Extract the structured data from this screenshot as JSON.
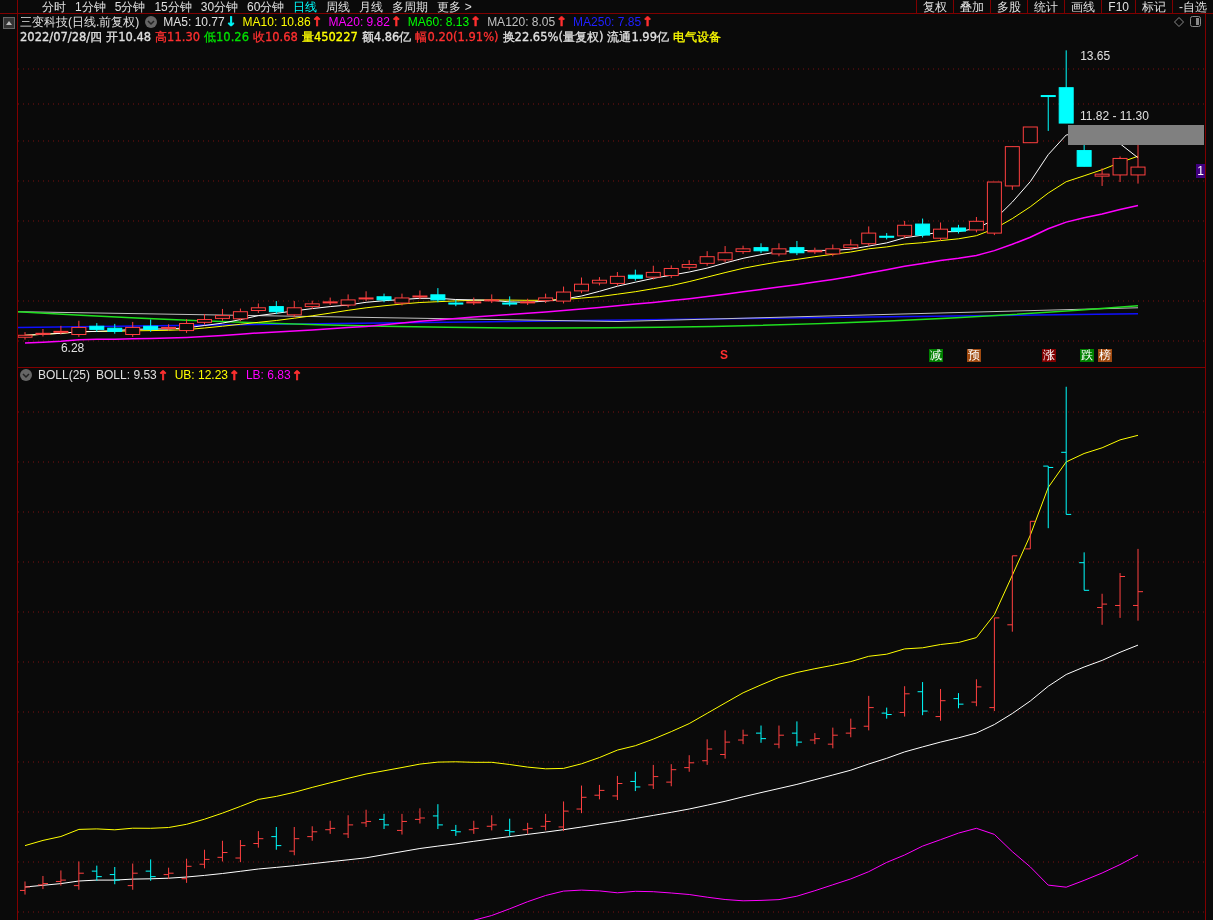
{
  "toolbar": {
    "tabs": [
      {
        "label": "分时",
        "selected": false
      },
      {
        "label": "1分钟",
        "selected": false
      },
      {
        "label": "5分钟",
        "selected": false
      },
      {
        "label": "15分钟",
        "selected": false
      },
      {
        "label": "30分钟",
        "selected": false
      },
      {
        "label": "60分钟",
        "selected": false
      },
      {
        "label": "日线",
        "selected": true
      },
      {
        "label": "周线",
        "selected": false
      },
      {
        "label": "月线",
        "selected": false
      },
      {
        "label": "多周期",
        "selected": false
      },
      {
        "label": "更多 >",
        "selected": false
      }
    ],
    "buttons": [
      "复权",
      "叠加",
      "多股",
      "统计",
      "画线",
      "F10",
      "标记",
      "-自选"
    ]
  },
  "header": {
    "title": "三变科技(日线.前复权)",
    "indicators": [
      {
        "label": "MA5: 10.77",
        "color": "#e0e0e0",
        "arrow": {
          "text": "↓",
          "color": "#00ffff"
        }
      },
      {
        "label": "MA10: 10.86",
        "color": "#ffff00",
        "arrow": {
          "text": "↑",
          "color": "#ff3030"
        }
      },
      {
        "label": "MA20: 9.82",
        "color": "#ff00ff",
        "arrow": {
          "text": "↑",
          "color": "#ff3030"
        }
      },
      {
        "label": "MA60: 8.13",
        "color": "#00ff00",
        "arrow": {
          "text": "↑",
          "color": "#ff3030"
        }
      },
      {
        "label": "MA120: 8.05",
        "color": "#c0c0c0",
        "arrow": {
          "text": "↑",
          "color": "#ff3030"
        }
      },
      {
        "label": "MA250: 7.85",
        "color": "#2020ff",
        "arrow": {
          "text": "↑",
          "color": "#ff3030"
        }
      }
    ],
    "quote": [
      {
        "text": "2022/07/28/四",
        "color": "#e0e0e0"
      },
      {
        "text": "开10.48",
        "color": "#e0e0e0"
      },
      {
        "text": "高11.30",
        "color": "#ff3030"
      },
      {
        "text": "低10.26",
        "color": "#00e000"
      },
      {
        "text": "收10.68",
        "color": "#ff3030"
      },
      {
        "text": "量450227",
        "color": "#ffff00"
      },
      {
        "text": "额4.86亿",
        "color": "#e0e0e0"
      },
      {
        "text": "幅0.20(1.91%)",
        "color": "#ff3030"
      },
      {
        "text": "换22.65%(量复权)",
        "color": "#e0e0e0"
      },
      {
        "text": "流通1.99亿",
        "color": "#e0e0e0"
      },
      {
        "text": "电气设备",
        "color": "#ffff00"
      }
    ]
  },
  "price_chart": {
    "high_label": "13.65",
    "range_label": "11.82 - 11.30",
    "low_label": "6.28",
    "axis_label": "1",
    "signals": [
      {
        "text": "S",
        "kind": "letter",
        "color": "#ff3030"
      },
      {
        "text": "减",
        "kind": "badge",
        "color": "#008000"
      },
      {
        "text": "预",
        "kind": "badge",
        "color": "#a04a10"
      },
      {
        "text": "涨",
        "kind": "badge",
        "color": "#800000"
      },
      {
        "text": "跌",
        "kind": "badge",
        "color": "#008000"
      },
      {
        "text": "榜",
        "kind": "badge",
        "color": "#a04a10"
      }
    ]
  },
  "boll": {
    "title": "BOLL(25)",
    "values": [
      {
        "label": "BOLL: 9.53",
        "color": "#e0e0e0",
        "arrow": {
          "text": "↑",
          "color": "#ff3030"
        }
      },
      {
        "label": "UB: 12.23",
        "color": "#ffff00",
        "arrow": {
          "text": "↑",
          "color": "#ff3030"
        }
      },
      {
        "label": "LB: 6.83",
        "color": "#ff00ff",
        "arrow": {
          "text": "↑",
          "color": "#ff3030"
        }
      }
    ]
  }
}
